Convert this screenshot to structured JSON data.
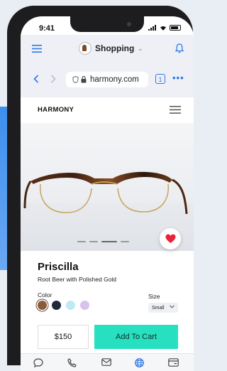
{
  "status_bar": {
    "time": "9:41"
  },
  "browser": {
    "app_title": "Shopping",
    "url": "harmony.com",
    "tab_count": "1"
  },
  "site": {
    "brand": "HARMONY"
  },
  "carousel": {
    "slide_count": 4,
    "active_index": 2
  },
  "product": {
    "name": "Priscilla",
    "subtitle": "Root Beer with Polished Gold",
    "color_label": "Color",
    "colors": [
      "#8a5a3c",
      "#1f2a3a",
      "#bfe9f3",
      "#d8c2ee"
    ],
    "selected_color": 0,
    "size_label": "Size",
    "size_value": "Small",
    "price": "$150",
    "cart_label": "Add To Cart",
    "favorited": true
  },
  "bottom_bar": {
    "tabs": [
      "chat-icon",
      "phone-icon",
      "mail-icon",
      "globe-icon",
      "wallet-icon"
    ],
    "active_tab": 3
  },
  "colors": {
    "accent": "#2e78e6",
    "cart": "#27e0bf",
    "heart": "#e8233a"
  }
}
